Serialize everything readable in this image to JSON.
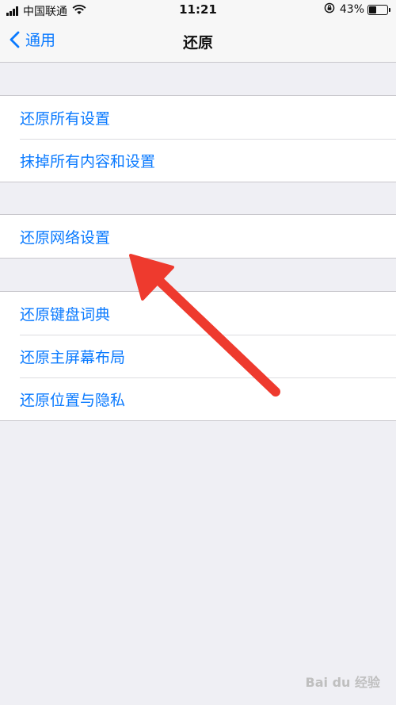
{
  "status_bar": {
    "carrier": "中国联通",
    "time": "11:21",
    "battery": "43%",
    "battery_level": 0.43
  },
  "nav": {
    "back_label": "通用",
    "title": "还原"
  },
  "groups": [
    {
      "items": [
        "还原所有设置",
        "抹掉所有内容和设置"
      ]
    },
    {
      "items": [
        "还原网络设置"
      ]
    },
    {
      "items": [
        "还原键盘词典",
        "还原主屏幕布局",
        "还原位置与隐私"
      ]
    }
  ],
  "colors": {
    "accent": "#0a7aff",
    "arrow": "#ee3a2e",
    "background": "#efeff4"
  },
  "watermark": "Bai du 经验"
}
